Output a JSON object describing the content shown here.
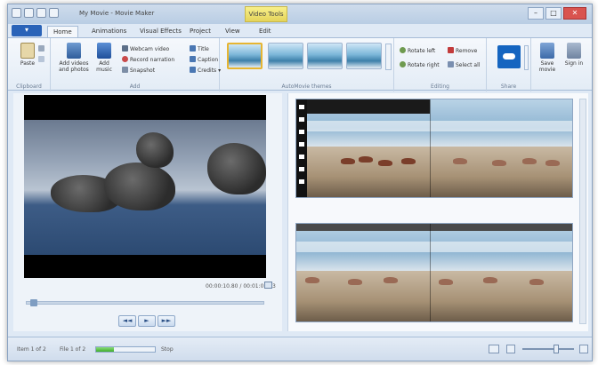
{
  "window": {
    "title": "My Movie - Movie Maker",
    "contextual_tab": "Video Tools"
  },
  "window_buttons": {
    "minimize": "–",
    "maximize": "□",
    "close": "✕"
  },
  "tabs": {
    "file": "▾",
    "items": [
      "Home",
      "Animations",
      "Visual Effects",
      "Project",
      "View",
      "Edit"
    ]
  },
  "ribbon": {
    "clipboard": {
      "label": "Clipboard",
      "paste": "Paste"
    },
    "add": {
      "label": "Add",
      "add_videos": "Add videos and photos",
      "add_music": "Add music",
      "webcam": "Webcam video",
      "record_narration": "Record narration",
      "snapshot": "Snapshot",
      "title": "Title",
      "caption": "Caption",
      "credits": "Credits ▾"
    },
    "themes": {
      "label": "AutoMovie themes"
    },
    "editing": {
      "label": "Editing",
      "rotate_left": "Rotate left",
      "rotate_right": "Rotate right",
      "remove": "Remove",
      "select_all": "Select all"
    },
    "share": {
      "label": "Share"
    },
    "save": {
      "save_movie": "Save movie",
      "sign_in": "Sign in"
    }
  },
  "preview": {
    "timecode": "00:00:10.80 / 00:01:06.13",
    "controls": {
      "prev": "◄◄",
      "play": "►",
      "next": "►►"
    },
    "progress": 0.02
  },
  "status": {
    "item": "Item 1 of 2",
    "file_progress": "File 1 of 2",
    "progress_value": 0.3,
    "cancel": "Stop",
    "zoom_value": 0.65
  },
  "colors": {
    "accent": "#2a63b8",
    "window_bg": "#dfe9f5",
    "progress_green": "#3fae2b",
    "share_tile": "#1565c0",
    "selected_theme_border": "#e6b532"
  }
}
